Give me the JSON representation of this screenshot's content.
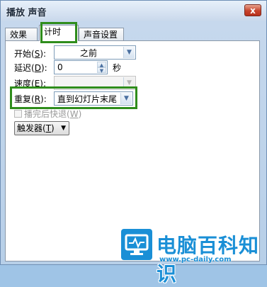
{
  "window": {
    "title": "播放 声音",
    "close_label": "x"
  },
  "tabs": [
    {
      "label": "效果"
    },
    {
      "label": "计时",
      "active": true
    },
    {
      "label": "声音设置"
    }
  ],
  "form": {
    "start_label": "开始(",
    "start_key": "S",
    "start_suffix": "):",
    "start_value": "之前",
    "delay_label": "延迟(",
    "delay_key": "D",
    "delay_suffix": "):",
    "delay_value": "0",
    "delay_unit": "秒",
    "speed_label": "速度(",
    "speed_key": "E",
    "speed_suffix": "):",
    "speed_value": "",
    "repeat_label": "重复(",
    "repeat_key": "R",
    "repeat_suffix": "):",
    "repeat_value": "直到幻灯片末尾",
    "rewind_label": "播完后快退(",
    "rewind_key": "W",
    "rewind_suffix": ")",
    "trigger_label": "触发器(",
    "trigger_key": "T",
    "trigger_suffix": ")"
  },
  "watermark": {
    "title": "电脑百科知识",
    "url": "www.pc-daily.com"
  },
  "colors": {
    "highlight": "#2f8d1c",
    "accent": "#1a8fd6"
  }
}
